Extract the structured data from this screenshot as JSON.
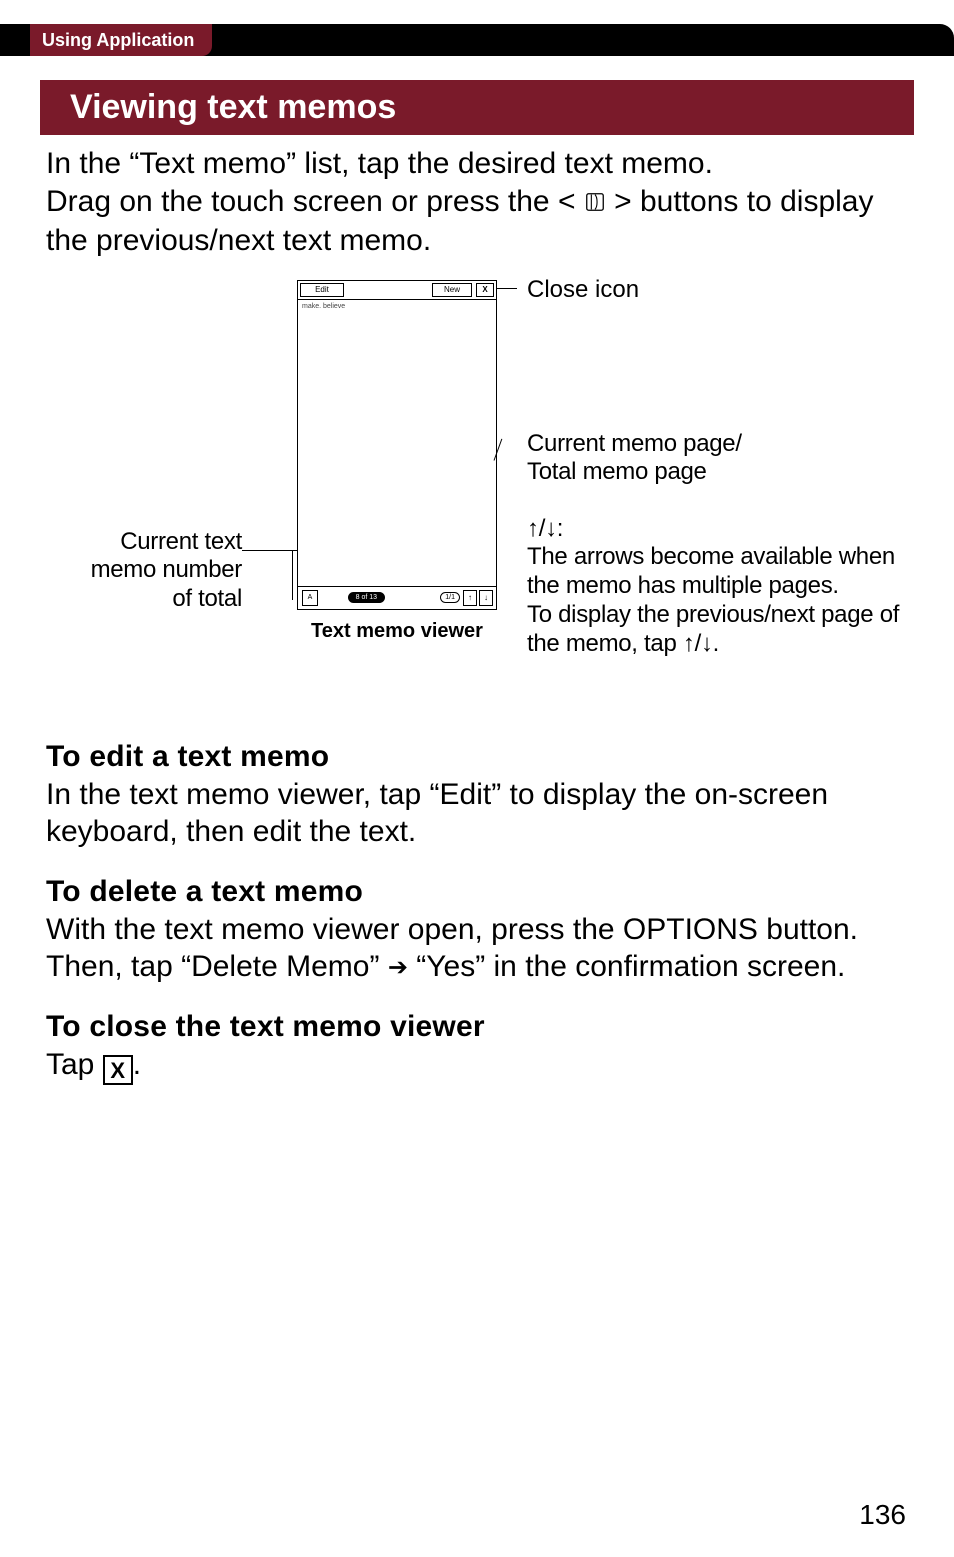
{
  "header": {
    "tab_label": "Using Application"
  },
  "section": {
    "heading": "Viewing text memos",
    "intro_line1": "In the “Text memo” list, tap the desired text memo.",
    "intro_line2_a": "Drag on the touch screen or press the < ",
    "intro_line2_b": " > buttons to display the previous/next text memo."
  },
  "diagram": {
    "viewer": {
      "edit_label": "Edit",
      "new_label": "New",
      "close_glyph": "X",
      "body_text": "make. believe",
      "counter": "8 of 13",
      "page_box": "1/1"
    },
    "caption": "Text memo viewer",
    "labels": {
      "close_icon": "Close icon",
      "current_memo_page": "Current memo page/\nTotal memo page",
      "arrows_heading_a": "↑",
      "arrows_heading_sep": "/",
      "arrows_heading_b": "↓",
      "arrows_heading_colon": ":",
      "arrows_body_1": "The arrows become available when the memo has multiple pages.",
      "arrows_body_2a": "To display the previous/next page of the memo, tap ",
      "arrows_body_2b": ".",
      "current_text_memo_number": "Current text memo number of total"
    }
  },
  "sections": {
    "edit": {
      "heading": "To edit a text memo",
      "body": "In the text memo viewer, tap “Edit” to display the on-screen keyboard, then edit the text."
    },
    "delete": {
      "heading": "To delete a text memo",
      "body_a": "With the text memo viewer open, press the OPTIONS button. Then, tap “Delete Memo” ",
      "body_b": " “Yes” in the confirmation screen."
    },
    "close": {
      "heading": "To close the text memo viewer",
      "body_a": "Tap ",
      "body_b": "."
    }
  },
  "page_number": "136"
}
